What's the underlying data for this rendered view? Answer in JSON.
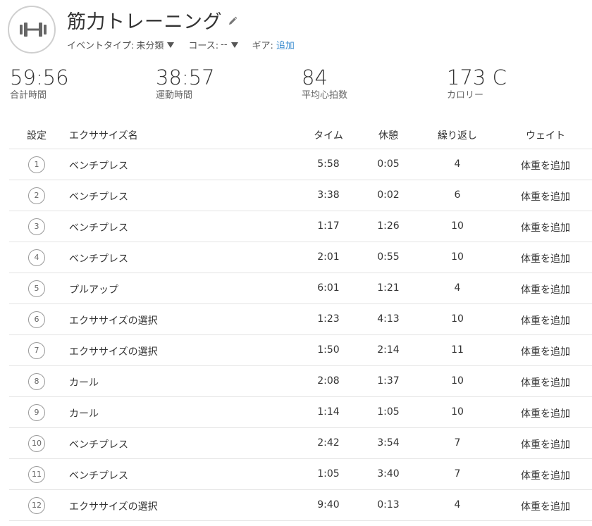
{
  "header": {
    "title": "筋力トレーニング",
    "event_type_label": "イベントタイプ:",
    "event_type_value": "未分類",
    "course_label": "コース:",
    "course_value": "--",
    "gear_label": "ギア:",
    "gear_value": "追加"
  },
  "stats": [
    {
      "value": "59:56",
      "label": "合計時間"
    },
    {
      "value": "38:57",
      "label": "運動時間"
    },
    {
      "value": "84",
      "label": "平均心拍数"
    },
    {
      "value": "173 C",
      "label": "カロリー"
    }
  ],
  "table": {
    "headers": {
      "set": "設定",
      "exercise": "エクササイズ名",
      "time": "タイム",
      "rest": "休憩",
      "reps": "繰り返し",
      "weight": "ウェイト"
    },
    "rows": [
      {
        "num": "1",
        "exercise": "ベンチプレス",
        "time": "5:58",
        "rest": "0:05",
        "reps": "4",
        "weight": "体重を追加",
        "link": false
      },
      {
        "num": "2",
        "exercise": "ベンチプレス",
        "time": "3:38",
        "rest": "0:02",
        "reps": "6",
        "weight": "体重を追加",
        "link": false
      },
      {
        "num": "3",
        "exercise": "ベンチプレス",
        "time": "1:17",
        "rest": "1:26",
        "reps": "10",
        "weight": "体重を追加",
        "link": false
      },
      {
        "num": "4",
        "exercise": "ベンチプレス",
        "time": "2:01",
        "rest": "0:55",
        "reps": "10",
        "weight": "体重を追加",
        "link": false
      },
      {
        "num": "5",
        "exercise": "プルアップ",
        "time": "6:01",
        "rest": "1:21",
        "reps": "4",
        "weight": "体重を追加",
        "link": false
      },
      {
        "num": "6",
        "exercise": "エクササイズの選択",
        "time": "1:23",
        "rest": "4:13",
        "reps": "10",
        "weight": "体重を追加",
        "link": true
      },
      {
        "num": "7",
        "exercise": "エクササイズの選択",
        "time": "1:50",
        "rest": "2:14",
        "reps": "11",
        "weight": "体重を追加",
        "link": true
      },
      {
        "num": "8",
        "exercise": "カール",
        "time": "2:08",
        "rest": "1:37",
        "reps": "10",
        "weight": "体重を追加",
        "link": false
      },
      {
        "num": "9",
        "exercise": "カール",
        "time": "1:14",
        "rest": "1:05",
        "reps": "10",
        "weight": "体重を追加",
        "link": false
      },
      {
        "num": "10",
        "exercise": "ベンチプレス",
        "time": "2:42",
        "rest": "3:54",
        "reps": "7",
        "weight": "体重を追加",
        "link": false
      },
      {
        "num": "11",
        "exercise": "ベンチプレス",
        "time": "1:05",
        "rest": "3:40",
        "reps": "7",
        "weight": "体重を追加",
        "link": false
      },
      {
        "num": "12",
        "exercise": "エクササイズの選択",
        "time": "9:40",
        "rest": "0:13",
        "reps": "4",
        "weight": "体重を追加",
        "link": true
      }
    ]
  },
  "icons": {
    "activity": "dumbbell-icon",
    "edit": "pencil-icon",
    "dropdown": "caret-down-icon"
  },
  "colors": {
    "link": "#3e8ed0",
    "text": "#333333",
    "divider": "#e3e3e3"
  }
}
